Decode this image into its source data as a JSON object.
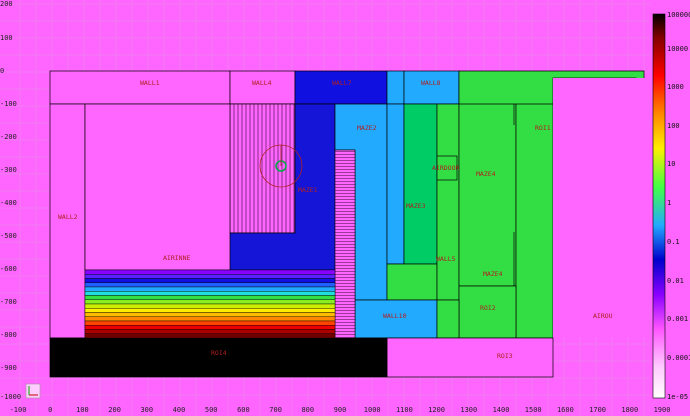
{
  "colors": {
    "background": "#ff66ff",
    "grid": "#e38ae3",
    "wall1": "#ff66ff",
    "wall2": "#ff66ff",
    "wall4": "#ff66ff",
    "wall7": "#1010e0",
    "wall8": "#22aaff",
    "maze1": "#1515d8",
    "maze2": "#22aaff",
    "maze3": "#00cc66",
    "maze4": "#33dd44",
    "roi1": "#33dd44",
    "roi2": "#33dd44",
    "roi3": "#ff66ff",
    "roi4": "#000000",
    "airinne": "#ff66ff",
    "airdoor": "#ff66ff",
    "wall5": "#33dd44",
    "wall10": "#22aaff"
  },
  "labels": {
    "wall1": "WALL1",
    "wall2": "WALL2",
    "wall4": "WALL4",
    "wall7": "WALL7",
    "wall8": "WALL8",
    "maze1": "MAZE1",
    "maze2": "MAZE2",
    "maze3": "MAZE3",
    "maze4a": "MAZE4",
    "maze4b": "MAZE4",
    "roi1": "ROI1",
    "roi2": "ROI2",
    "roi3": "ROI3",
    "roi4": "ROI4",
    "airinne": "AIRINNE",
    "airdoor": "AIRDOOR",
    "airou": "AIROU",
    "wall5": "WALL5",
    "wall10": "WALL10"
  },
  "axes": {
    "y_ticks": [
      "100",
      "0",
      "-100",
      "-200",
      "-300",
      "-400",
      "-500",
      "-600",
      "-700",
      "-800",
      "-900",
      "-1000"
    ],
    "y_top_label": "200",
    "x_ticks": [
      "-100",
      "0",
      "100",
      "200",
      "300",
      "400",
      "500",
      "600",
      "700",
      "800",
      "900",
      "1000",
      "1100",
      "1200",
      "1300",
      "1400",
      "1500",
      "1600",
      "1700",
      "1800",
      "1900"
    ]
  },
  "colorbar": {
    "ticks": [
      "10000",
      "1000",
      "100",
      "10",
      "1",
      "0.1",
      "0.01",
      "0.001",
      "0.0001",
      "1e-05"
    ],
    "top_label": "100000"
  }
}
